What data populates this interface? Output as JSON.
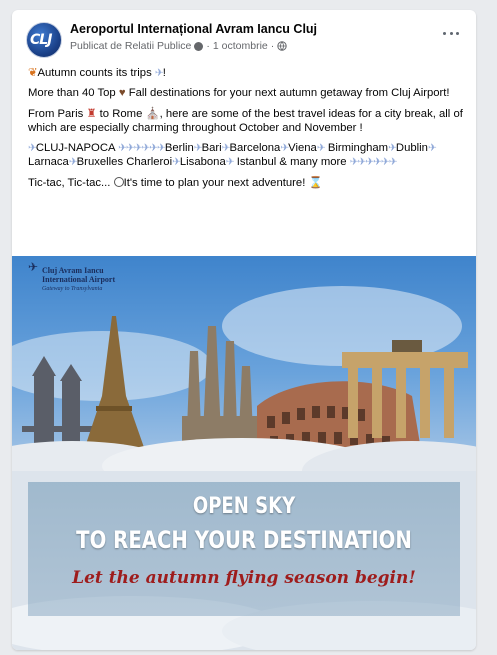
{
  "post": {
    "page_name": "Aeroportul Internațional Avram Iancu Cluj",
    "avatar_text": "CLJ",
    "meta_author": "Publicat de Relatii Publice",
    "meta_date": "1 octombrie",
    "text": {
      "line1": "Autumn counts its trips",
      "line2a": "More than 40 Top",
      "line2b": "Fall destinations for your next autumn getaway from Cluj Airport!",
      "line3a": "From Paris",
      "line3b": "to Rome",
      "line3c": ", here are some of the best travel ideas for a city break, all of which are especially charming throughout October and November !",
      "destinations": [
        "CLUJ-NAPOCA",
        "Berlin",
        "Bari",
        "Barcelona",
        "Viena",
        "Birmingham",
        "Dublin",
        "Larnaca",
        "Bruxelles Charleroi",
        "Lisabona",
        "Istanbul & many more"
      ],
      "line5a": "Tic-tac, Tic-tac...",
      "line5b": "It's time to plan your next adventure!"
    }
  },
  "poster": {
    "logo_line1": "Cluj Avram Iancu",
    "logo_line2": "International Airport",
    "logo_tagline": "Gateway to Transylvania",
    "headline1": "OPEN SKY",
    "headline2": "TO REACH YOUR DESTINATION",
    "script_line": "Let the autumn flying season begin!"
  },
  "icons": [
    "leaf-icon",
    "plane-icon",
    "heart-icon",
    "pin-icon",
    "hourglass-icon",
    "clock-icon",
    "globe-icon",
    "more-icon"
  ],
  "colors": {
    "meta_gray": "#65676b",
    "banner_red": "#9e1c1c",
    "sky_blue": "#3f84cc"
  }
}
